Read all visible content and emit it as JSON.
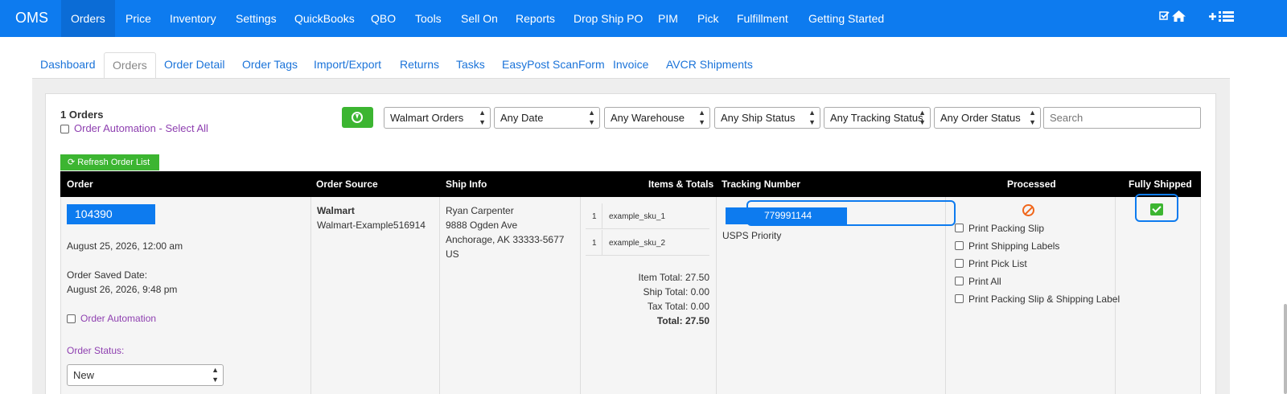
{
  "brand": "OMS",
  "nav": [
    "Orders",
    "Price",
    "Inventory",
    "Settings",
    "QuickBooks",
    "QBO",
    "Tools",
    "Sell On",
    "Reports",
    "Drop Ship PO",
    "PIM",
    "Pick",
    "Fulfillment",
    "Getting Started"
  ],
  "nav_icons": [
    "checkbox-icon",
    "home-icon",
    "add-list-icon"
  ],
  "tabs": [
    "Dashboard",
    "Orders",
    "Order Detail",
    "Order Tags",
    "Import/Export",
    "Returns",
    "Tasks",
    "EasyPost ScanForm",
    "Invoice",
    "AVCR Shipments"
  ],
  "active_tab": "Orders",
  "toolbar": {
    "count": "1 Orders",
    "select_all": "Order Automation - Select All",
    "filters": [
      "Walmart Orders",
      "Any Date",
      "Any Warehouse",
      "Any Ship Status",
      "Any Tracking Status",
      "Any Order Status"
    ],
    "search_placeholder": "Search",
    "refresh": "Refresh Order List"
  },
  "columns": [
    "Order",
    "Order Source",
    "Ship Info",
    "Items & Totals",
    "Tracking Number",
    "Processed",
    "Fully Shipped"
  ],
  "order": {
    "number": "104390",
    "date": "August 25, 2026, 12:00 am",
    "saved_label": "Order Saved Date:",
    "saved_date": "August 26, 2026, 9:48 pm",
    "automation": "Order Automation",
    "status_label": "Order Status:",
    "status_value": "New",
    "source_name": "Walmart",
    "source_account": "Walmart-Example516914",
    "ship": [
      "Ryan Carpenter",
      "9888 Ogden Ave",
      "Anchorage, AK 33333-5677",
      "US"
    ],
    "items": [
      {
        "qty": "1",
        "sku": "example_sku_1"
      },
      {
        "qty": "1",
        "sku": "example_sku_2"
      }
    ],
    "totals": [
      "Item Total: 27.50",
      "Ship Total: 0.00",
      "Tax Total: 0.00",
      "Total: 27.50"
    ],
    "tracking_number": "779991144",
    "carrier": "USPS Priority",
    "print_options": [
      "Print Packing Slip",
      "Print Shipping Labels",
      "Print Pick List",
      "Print All",
      "Print Packing Slip & Shipping Label"
    ]
  },
  "colors": {
    "nav": "#0d7bef",
    "accent_green": "#3cb531",
    "purple": "#8e3fb0",
    "processed_icon": "#f0661a"
  }
}
